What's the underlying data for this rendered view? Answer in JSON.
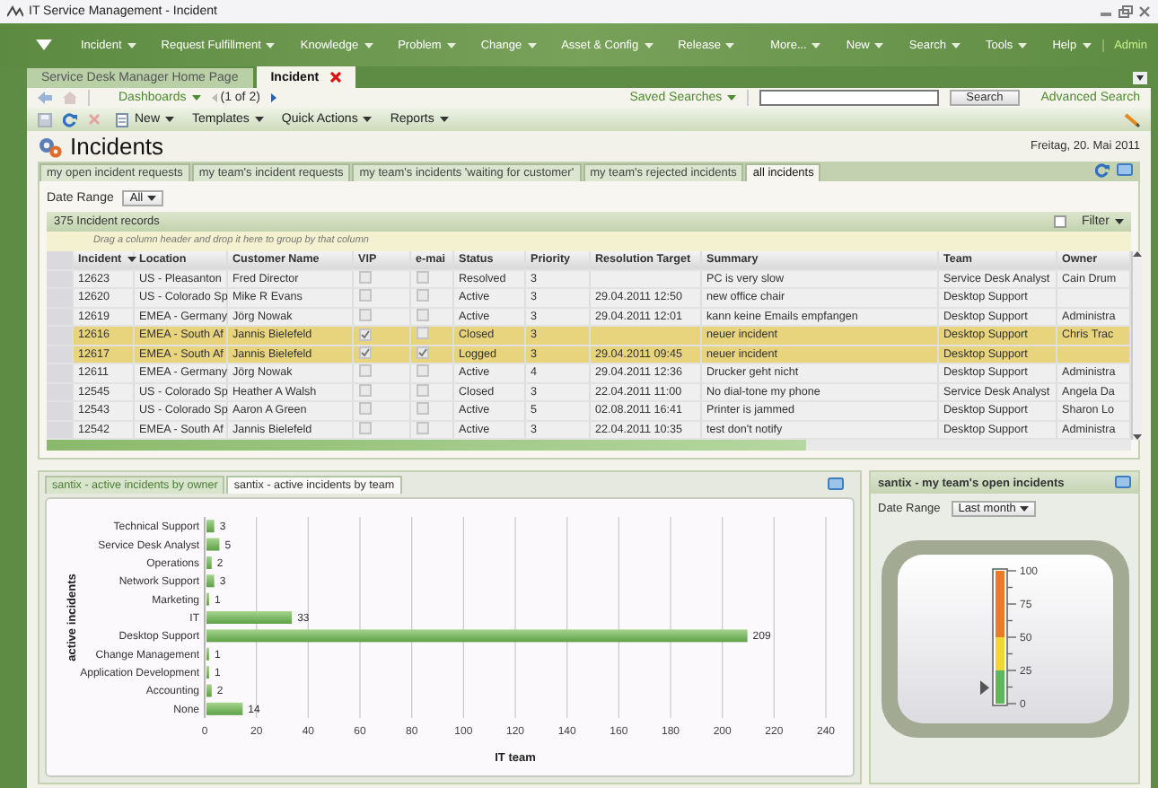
{
  "window": {
    "title": "IT Service Management - Incident"
  },
  "nav": {
    "left": [
      {
        "label": "Incident"
      },
      {
        "label": "Request Fulfillment"
      },
      {
        "label": "Knowledge"
      },
      {
        "label": "Problem"
      },
      {
        "label": "Change"
      },
      {
        "label": "Asset & Config"
      },
      {
        "label": "Release"
      }
    ],
    "right": [
      {
        "label": "More..."
      },
      {
        "label": "New"
      },
      {
        "label": "Search"
      },
      {
        "label": "Tools"
      },
      {
        "label": "Help"
      }
    ],
    "user": "Admin"
  },
  "page_tabs": [
    {
      "label": "Service Desk Manager Home Page",
      "selected": false
    },
    {
      "label": "Incident",
      "selected": true
    }
  ],
  "toolbar": {
    "dashboards": "Dashboards",
    "paging": "(1 of 2)",
    "saved_searches": "Saved Searches",
    "search_button": "Search",
    "advanced_search": "Advanced Search"
  },
  "actions": [
    {
      "label": "New"
    },
    {
      "label": "Templates"
    },
    {
      "label": "Quick Actions"
    },
    {
      "label": "Reports"
    }
  ],
  "header": {
    "title": "Incidents",
    "date": "Freitag, 20. Mai 2011"
  },
  "view_tabs": [
    {
      "label": "my open incident requests",
      "selected": false
    },
    {
      "label": "my team's incident requests",
      "selected": false
    },
    {
      "label": "my team's incidents 'waiting for customer'",
      "selected": false
    },
    {
      "label": "my team's rejected incidents",
      "selected": false
    },
    {
      "label": "all incidents",
      "selected": true
    }
  ],
  "date_range": {
    "label": "Date Range",
    "value": "All"
  },
  "grid": {
    "count": "375 Incident records",
    "filter": "Filter",
    "filter_checked": false,
    "hint": "Drag a column header and drop it here to group by that column"
  },
  "columns": [
    {
      "label": "Incident",
      "sorted": true
    },
    {
      "label": "Location",
      "sorted": false
    },
    {
      "label": "Customer Name",
      "sorted": false
    },
    {
      "label": "VIP",
      "sorted": false
    },
    {
      "label": "e-mai",
      "sorted": false
    },
    {
      "label": "Status",
      "sorted": false
    },
    {
      "label": "Priority",
      "sorted": false
    },
    {
      "label": "Resolution Target",
      "sorted": false
    },
    {
      "label": "Summary",
      "sorted": false
    },
    {
      "label": "Team",
      "sorted": false
    },
    {
      "label": "Owner",
      "sorted": false
    }
  ],
  "rows": [
    {
      "incident": "12623",
      "location": "US - Pleasanton",
      "customer": "Fred Director",
      "vip": false,
      "email": false,
      "status": "Resolved",
      "priority": "3",
      "summary": "PC is very slow",
      "team": "Service Desk Analyst",
      "owner": "Cain Drum",
      "selected": false
    },
    {
      "incident": "12620",
      "location": "US - Colorado Sp",
      "customer": "Mike R Evans",
      "vip": false,
      "email": false,
      "status": "Active",
      "priority": "3",
      "resolution_target": "29.04.2011 12:50",
      "summary": "new office chair",
      "team": "Desktop Support",
      "selected": false
    },
    {
      "incident": "12619",
      "location": "EMEA - Germany",
      "customer": "Jörg Nowak",
      "vip": false,
      "email": false,
      "status": "Active",
      "priority": "3",
      "resolution_target": "29.04.2011 12:01",
      "summary": "kann keine Emails empfangen",
      "team": "Desktop Support",
      "owner": "Administra",
      "selected": false
    },
    {
      "incident": "12616",
      "location": "EMEA - South Af",
      "customer": "Jannis Bielefeld",
      "vip": true,
      "email": false,
      "status": "Closed",
      "priority": "3",
      "summary": "neuer incident",
      "team": "Desktop Support",
      "owner": "Chris Trac",
      "selected": true
    },
    {
      "incident": "12617",
      "location": "EMEA - South Af",
      "customer": "Jannis Bielefeld",
      "vip": true,
      "email": true,
      "status": "Logged",
      "priority": "3",
      "resolution_target": "29.04.2011 09:45",
      "summary": "neuer incident",
      "team": "Desktop Support",
      "selected": true
    },
    {
      "incident": "12611",
      "location": "EMEA - Germany",
      "customer": "Jörg Nowak",
      "vip": false,
      "email": false,
      "status": "Active",
      "priority": "4",
      "resolution_target": "29.04.2011 12:36",
      "summary": "Drucker geht nicht",
      "team": "Desktop Support",
      "owner": "Administra",
      "selected": false
    },
    {
      "incident": "12545",
      "location": "US - Colorado Sp",
      "customer": "Heather A Walsh",
      "vip": false,
      "email": false,
      "status": "Closed",
      "priority": "3",
      "resolution_target": "22.04.2011 11:00",
      "summary": "No dial-tone my phone",
      "team": "Service Desk Analyst",
      "owner": "Angela Da",
      "selected": false
    },
    {
      "incident": "12543",
      "location": "US - Colorado Sp",
      "customer": "Aaron A Green",
      "vip": false,
      "email": false,
      "status": "Active",
      "priority": "5",
      "resolution_target": "02.08.2011 16:41",
      "summary": "Printer is jammed",
      "team": "Desktop Support",
      "owner": "Sharon Lo",
      "selected": false
    },
    {
      "incident": "12542",
      "location": "EMEA - South Af",
      "customer": "Jannis Bielefeld",
      "vip": false,
      "email": false,
      "status": "Active",
      "priority": "3",
      "resolution_target": "22.04.2011 10:35",
      "summary": "test don't notify",
      "team": "Desktop Support",
      "owner": "Administra",
      "selected": false
    }
  ],
  "chart_panel": {
    "tabs": [
      {
        "label": "santix - active incidents by owner",
        "selected": false
      },
      {
        "label": "santix - active incidents by team",
        "selected": true
      }
    ],
    "chart_data": {
      "type": "bar",
      "orientation": "horizontal",
      "xlabel": "IT team",
      "ylabel": "active incidents",
      "categories": [
        "Technical Support",
        "Service Desk Analyst",
        "Operations",
        "Network Support",
        "Marketing",
        "IT",
        "Desktop Support",
        "Change Management",
        "Application Development",
        "Accounting",
        "None"
      ],
      "values": [
        3,
        5,
        2,
        3,
        1,
        33,
        209,
        1,
        1,
        2,
        14
      ],
      "xlim": [
        0,
        240
      ],
      "grid": true,
      "xticks": [
        0,
        20,
        40,
        60,
        80,
        100,
        120,
        140,
        160,
        180,
        200,
        220,
        240
      ],
      "data_labels": true
    }
  },
  "gauge_panel": {
    "title": "santix - my team's open incidents",
    "date_label": "Date Range",
    "date_value": "Last month",
    "level": 0.12,
    "scale": [
      "100",
      "75",
      "50",
      "25",
      "0"
    ]
  }
}
